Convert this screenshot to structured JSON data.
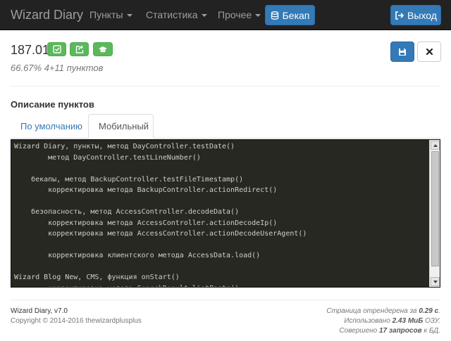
{
  "navbar": {
    "brand": "Wizard Diary",
    "menu": [
      {
        "label": "Пункты"
      },
      {
        "label": "Статистика"
      },
      {
        "label": "Прочее"
      }
    ],
    "backup_label": "Бекап",
    "logout_label": "Выход"
  },
  "header": {
    "title": "187.01",
    "subtitle": "66.67% 4+11 пунктов"
  },
  "section_title": "Описание пунктов",
  "tabs": [
    {
      "label": "По умолчанию",
      "active": false
    },
    {
      "label": "Мобильный",
      "active": true
    }
  ],
  "code_lines": [
    "Wizard Diary, пункты, метод DayController.testDate()",
    "        метод DayController.testLineNumber()",
    "",
    "    бекапы, метод BackupController.testFileTimestamp()",
    "        корректировка метода BackupController.actionRedirect()",
    "",
    "    безопасность, метод AccessController.decodeData()",
    "        корректировка метода AccessController.actionDecodeIp()",
    "        корректировка метода AccessController.actionDecodeUserAgent()",
    "",
    "        корректировка клиентского метода AccessData.load()",
    "",
    "Wizard Blog New, CMS, функция onStart()",
    "        корректировка метода SearchResult.listPosts()"
  ],
  "footer": {
    "app_version": "Wizard Diary, v7.0",
    "copyright": "Copyright © 2014-2016 thewizardplusplus",
    "render_prefix": "Страница отрендерена за ",
    "render_value": "0.29 с",
    "render_suffix": ".",
    "memory_prefix": "Использовано ",
    "memory_value": "2.43 МиБ",
    "memory_suffix": " ОЗУ.",
    "queries_prefix": "Совершено ",
    "queries_value": "17 запросов",
    "queries_suffix": " к БД."
  },
  "colors": {
    "navbar": "#222222",
    "primary": "#337ab7",
    "success": "#5cb85c",
    "code_bg": "#272822"
  },
  "icons": {
    "backup": "database-icon",
    "logout": "sign-out-icon",
    "save": "floppy-disk-icon",
    "close": "close-icon",
    "check": "check-square-icon",
    "share": "share-square-icon",
    "graduation": "graduation-cap-icon"
  }
}
